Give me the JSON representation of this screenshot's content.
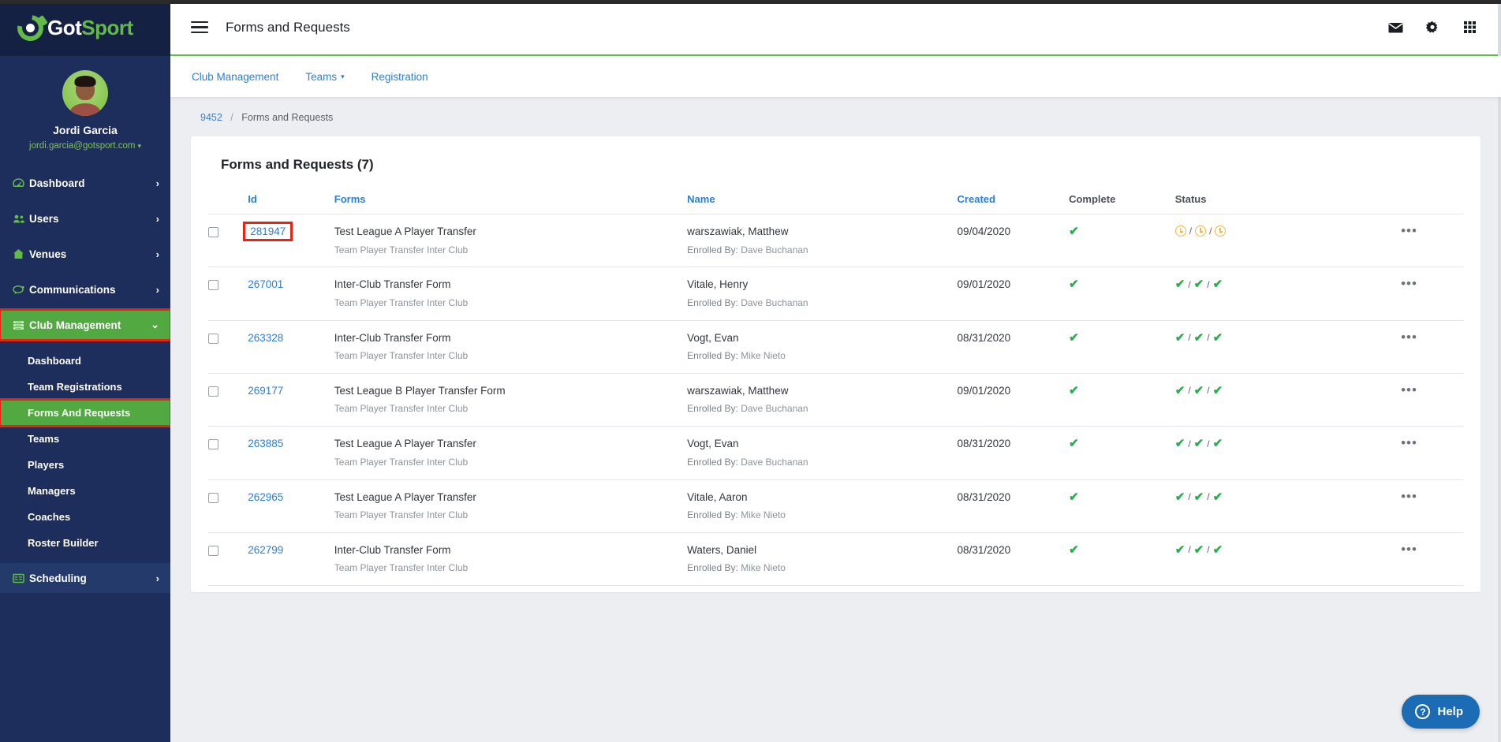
{
  "brand": {
    "name_part1": "Got",
    "name_part2": "Sport",
    "green": "#62bb46",
    "navy": "#1d2d5c"
  },
  "profile": {
    "name": "Jordi Garcia",
    "email": "jordi.garcia@gotsport.com",
    "caret": "▾"
  },
  "sidebar": {
    "items": [
      {
        "label": "Dashboard",
        "icon": "dashboard-icon",
        "glyph": "◕",
        "arrow": "›"
      },
      {
        "label": "Users",
        "icon": "users-icon",
        "glyph": "👥",
        "arrow": "›"
      },
      {
        "label": "Venues",
        "icon": "venue-icon",
        "glyph": "⌂",
        "arrow": "›"
      },
      {
        "label": "Communications",
        "icon": "chat-icon",
        "glyph": "💬",
        "arrow": "›"
      },
      {
        "label": "Club Management",
        "icon": "list-icon",
        "glyph": "▤",
        "arrow": "⌄"
      }
    ],
    "sub_items": [
      {
        "label": "Dashboard"
      },
      {
        "label": "Team Registrations"
      },
      {
        "label": "Forms And Requests"
      },
      {
        "label": "Teams"
      },
      {
        "label": "Players"
      },
      {
        "label": "Managers"
      },
      {
        "label": "Coaches"
      },
      {
        "label": "Roster Builder"
      }
    ],
    "scheduling": {
      "label": "Scheduling",
      "icon": "calendar-icon",
      "glyph": "▤",
      "arrow": "›"
    }
  },
  "topbar": {
    "title": "Forms and Requests",
    "icons": [
      {
        "name": "mail-icon",
        "glyph": "✉"
      },
      {
        "name": "gear-icon",
        "glyph": "⚙"
      },
      {
        "name": "apps-grid-icon",
        "glyph": "▦"
      }
    ]
  },
  "subnav": {
    "items": [
      {
        "label": "Club Management",
        "caret": ""
      },
      {
        "label": "Teams",
        "caret": "▾"
      },
      {
        "label": "Registration",
        "caret": ""
      }
    ]
  },
  "breadcrumb": {
    "root": "9452",
    "separator": "/",
    "current": "Forms and Requests"
  },
  "card": {
    "title": "Forms and Requests (7)"
  },
  "table": {
    "headers": {
      "id": "Id",
      "forms": "Forms",
      "name": "Name",
      "created": "Created",
      "complete": "Complete",
      "status": "Status"
    },
    "enrolled_label": "Enrolled By:",
    "dots_glyph": "•••",
    "rows": [
      {
        "id": "281947",
        "form": "Test League A Player Transfer",
        "form_sub": "Team Player Transfer Inter Club",
        "name": "warszawiak, Matthew",
        "enrolled_by": "Dave Buchanan",
        "created": "09/04/2020",
        "complete": true,
        "status": [
          "pending",
          "pending",
          "pending"
        ],
        "highlighted": true
      },
      {
        "id": "267001",
        "form": "Inter-Club Transfer Form",
        "form_sub": "Team Player Transfer Inter Club",
        "name": "Vitale, Henry",
        "enrolled_by": "Dave Buchanan",
        "created": "09/01/2020",
        "complete": true,
        "status": [
          "approved",
          "approved",
          "approved"
        ],
        "highlighted": false
      },
      {
        "id": "263328",
        "form": "Inter-Club Transfer Form",
        "form_sub": "Team Player Transfer Inter Club",
        "name": "Vogt, Evan",
        "enrolled_by": "Mike Nieto",
        "created": "08/31/2020",
        "complete": true,
        "status": [
          "approved",
          "approved",
          "approved"
        ],
        "highlighted": false
      },
      {
        "id": "269177",
        "form": "Test League B Player Transfer Form",
        "form_sub": "Team Player Transfer Inter Club",
        "name": "warszawiak, Matthew",
        "enrolled_by": "Dave Buchanan",
        "created": "09/01/2020",
        "complete": true,
        "status": [
          "approved",
          "approved",
          "approved"
        ],
        "highlighted": false
      },
      {
        "id": "263885",
        "form": "Test League A Player Transfer",
        "form_sub": "Team Player Transfer Inter Club",
        "name": "Vogt, Evan",
        "enrolled_by": "Dave Buchanan",
        "created": "08/31/2020",
        "complete": true,
        "status": [
          "approved",
          "approved",
          "approved"
        ],
        "highlighted": false
      },
      {
        "id": "262965",
        "form": "Test League A Player Transfer",
        "form_sub": "Team Player Transfer Inter Club",
        "name": "Vitale, Aaron",
        "enrolled_by": "Mike Nieto",
        "created": "08/31/2020",
        "complete": true,
        "status": [
          "approved",
          "approved",
          "approved"
        ],
        "highlighted": false
      },
      {
        "id": "262799",
        "form": "Inter-Club Transfer Form",
        "form_sub": "Team Player Transfer Inter Club",
        "name": "Waters, Daniel",
        "enrolled_by": "Mike Nieto",
        "created": "08/31/2020",
        "complete": true,
        "status": [
          "approved",
          "approved",
          "approved"
        ],
        "highlighted": false
      }
    ]
  },
  "help": {
    "label": "Help",
    "icon_glyph": "?",
    "color": "#1b6bb5"
  },
  "annotations": {
    "highlight_color": "#e8230f",
    "active_color": "#52a942"
  }
}
